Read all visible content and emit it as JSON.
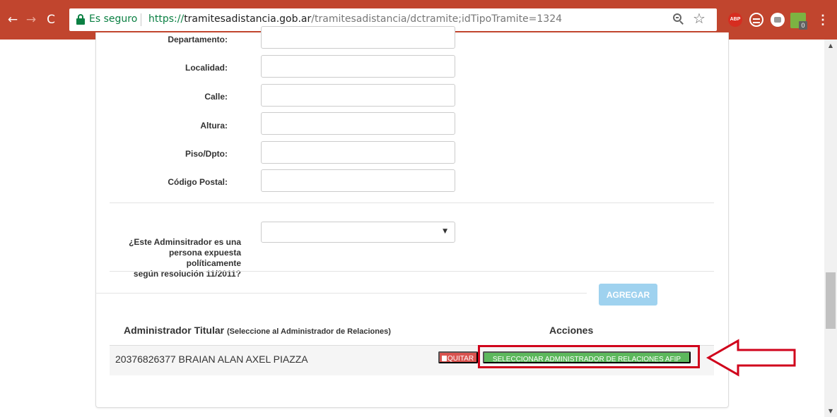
{
  "browser": {
    "nav": {
      "back_icon": "←",
      "forward_icon": "→",
      "reload_icon": "C"
    },
    "security_label": "Es seguro",
    "url": {
      "scheme": "https://",
      "host": "tramitesadistancia.gob.ar",
      "path": "/tramitesadistancia/dctramite;idTipoTramite=1324"
    },
    "toolbar_icons": [
      "zoom-icon",
      "star-icon",
      "adblock-plus-icon",
      "sync-icon",
      "snap-icon",
      "store-icon",
      "menu-icon"
    ],
    "abp_label": "ABP",
    "store_badge": "0",
    "star_glyph": "☆",
    "menu_glyph": "⋮"
  },
  "form": {
    "fields": [
      {
        "label": "Departamento:",
        "value": ""
      },
      {
        "label": "Localidad:",
        "value": ""
      },
      {
        "label": "Calle:",
        "value": ""
      },
      {
        "label": "Altura:",
        "value": ""
      },
      {
        "label": "Piso/Dpto:",
        "value": ""
      },
      {
        "label": "Código Postal:",
        "value": ""
      }
    ],
    "pep": {
      "label_line1": "¿Este Adminsitrador es una",
      "label_line2": "persona expuesta políticamente",
      "label_line3": "según resolución 11/2011?",
      "selected": "",
      "caret": "▼"
    },
    "add_button": "AGREGAR"
  },
  "table": {
    "header_admin": "Administrador Titular",
    "header_admin_hint": "(Seleccione al Administrador de Relaciones)",
    "header_actions": "Acciones",
    "rows": [
      {
        "admin": "20376826377 BRAIAN ALAN AXEL PIAZZA",
        "remove_label": "QUITAR",
        "select_label": "SELECCIONAR ADMINISTRADOR DE RELACIONES AFIP"
      }
    ]
  },
  "scrollbar": {
    "up": "▲",
    "down": "▼"
  },
  "colors": {
    "chrome": "#c1452e",
    "secure": "#0b8043",
    "add_button": "#9fd2ef",
    "remove_button": "#d9534f",
    "select_button": "#5cb85c",
    "annotation": "#d0021b"
  }
}
